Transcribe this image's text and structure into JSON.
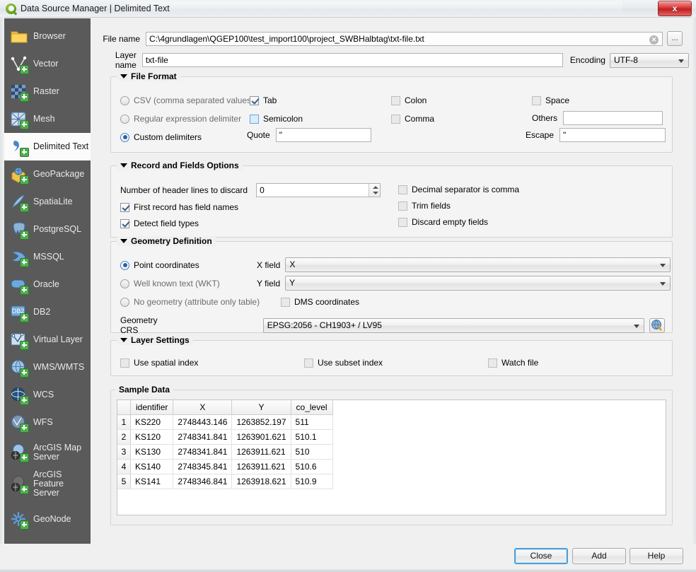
{
  "window": {
    "title": "Data Source Manager | Delimited Text",
    "app_icon": "qgis-logo-icon",
    "close_label": "x"
  },
  "sidebar": {
    "items": [
      {
        "label": "Browser",
        "icon": "folder-icon",
        "selected": false
      },
      {
        "label": "Vector",
        "icon": "vector-icon",
        "selected": false
      },
      {
        "label": "Raster",
        "icon": "raster-icon",
        "selected": false
      },
      {
        "label": "Mesh",
        "icon": "mesh-icon",
        "selected": false
      },
      {
        "label": "Delimited Text",
        "icon": "delimited-text-icon",
        "selected": true
      },
      {
        "label": "GeoPackage",
        "icon": "geopackage-icon",
        "selected": false
      },
      {
        "label": "SpatiaLite",
        "icon": "spatialite-icon",
        "selected": false
      },
      {
        "label": "PostgreSQL",
        "icon": "postgresql-icon",
        "selected": false
      },
      {
        "label": "MSSQL",
        "icon": "mssql-icon",
        "selected": false
      },
      {
        "label": "Oracle",
        "icon": "oracle-icon",
        "selected": false
      },
      {
        "label": "DB2",
        "icon": "db2-icon",
        "selected": false
      },
      {
        "label": "Virtual Layer",
        "icon": "virtual-layer-icon",
        "selected": false
      },
      {
        "label": "WMS/WMTS",
        "icon": "wms-icon",
        "selected": false
      },
      {
        "label": "WCS",
        "icon": "wcs-icon",
        "selected": false
      },
      {
        "label": "WFS",
        "icon": "wfs-icon",
        "selected": false
      },
      {
        "label": "ArcGIS Map Server",
        "icon": "arcgis-map-server-icon",
        "selected": false
      },
      {
        "label": "ArcGIS Feature Server",
        "icon": "arcgis-feature-server-icon",
        "selected": false
      },
      {
        "label": "GeoNode",
        "icon": "geonode-icon",
        "selected": false
      }
    ]
  },
  "source": {
    "file_name_label": "File name",
    "file_name_value": "C:\\4grundlagen\\QGEP100\\test_import100\\project_SWBHalbtag\\txt-file.txt",
    "clear_icon": "clear-x-icon",
    "browse_label": "...",
    "layer_name_label": "Layer name",
    "layer_name_value": "txt-file",
    "encoding_label": "Encoding",
    "encoding_value": "UTF-8"
  },
  "file_format": {
    "title": "File Format",
    "radios": [
      {
        "label": "CSV (comma separated values)",
        "checked": false
      },
      {
        "label": "Regular expression delimiter",
        "checked": false
      },
      {
        "label": "Custom delimiters",
        "checked": true
      }
    ],
    "delimiters": [
      {
        "label": "Tab",
        "checked": true,
        "highlight": false
      },
      {
        "label": "Colon",
        "checked": false,
        "highlight": false
      },
      {
        "label": "Space",
        "checked": false,
        "highlight": false
      },
      {
        "label": "Semicolon",
        "checked": false,
        "highlight": true
      },
      {
        "label": "Comma",
        "checked": false,
        "highlight": false
      }
    ],
    "others_label": "Others",
    "others_value": "",
    "quote_label": "Quote",
    "quote_value": "\"",
    "escape_label": "Escape",
    "escape_value": "\""
  },
  "record_fields": {
    "title": "Record and Fields Options",
    "header_lines_label": "Number of header lines to discard",
    "header_lines_value": "0",
    "left_checks": [
      {
        "label": "First record has field names",
        "checked": true
      },
      {
        "label": "Detect field types",
        "checked": true
      }
    ],
    "right_checks": [
      {
        "label": "Decimal separator is comma",
        "checked": false
      },
      {
        "label": "Trim fields",
        "checked": false
      },
      {
        "label": "Discard empty fields",
        "checked": false
      }
    ]
  },
  "geometry": {
    "title": "Geometry Definition",
    "radios": [
      {
        "label": "Point coordinates",
        "checked": true
      },
      {
        "label": "Well known text (WKT)",
        "checked": false
      },
      {
        "label": "No geometry (attribute only table)",
        "checked": false
      }
    ],
    "x_field_label": "X field",
    "x_field_value": "X",
    "y_field_label": "Y field",
    "y_field_value": "Y",
    "dms_label": "DMS coordinates",
    "dms_checked": false,
    "crs_label": "Geometry CRS",
    "crs_value": "EPSG:2056 - CH1903+ / LV95",
    "crs_button_icon": "crs-select-icon"
  },
  "layer_settings": {
    "title": "Layer Settings",
    "checks": [
      {
        "label": "Use spatial index",
        "checked": false
      },
      {
        "label": "Use subset index",
        "checked": false
      },
      {
        "label": "Watch file",
        "checked": false
      }
    ]
  },
  "sample_data": {
    "title": "Sample Data",
    "columns": [
      "identifier",
      "X",
      "Y",
      "co_level"
    ],
    "rows": [
      {
        "n": "1",
        "cells": [
          "KS220",
          "2748443.146",
          "1263852.197",
          "511"
        ]
      },
      {
        "n": "2",
        "cells": [
          "KS120",
          "2748341.841",
          "1263901.621",
          "510.1"
        ]
      },
      {
        "n": "3",
        "cells": [
          "KS130",
          "2748341.841",
          "1263911.621",
          "510"
        ]
      },
      {
        "n": "4",
        "cells": [
          "KS140",
          "2748345.841",
          "1263911.621",
          "510.6"
        ]
      },
      {
        "n": "5",
        "cells": [
          "KS141",
          "2748346.841",
          "1263918.621",
          "510.9"
        ]
      }
    ]
  },
  "footer": {
    "close_label": "Close",
    "add_label": "Add",
    "help_label": "Help"
  },
  "colors": {
    "accent": "#2166a8",
    "sidebar_bg": "#5a5a5a",
    "dialog_bg": "#f0f0f0",
    "close_red": "#c01f1f",
    "focus_blue": "#4a9fd8"
  }
}
